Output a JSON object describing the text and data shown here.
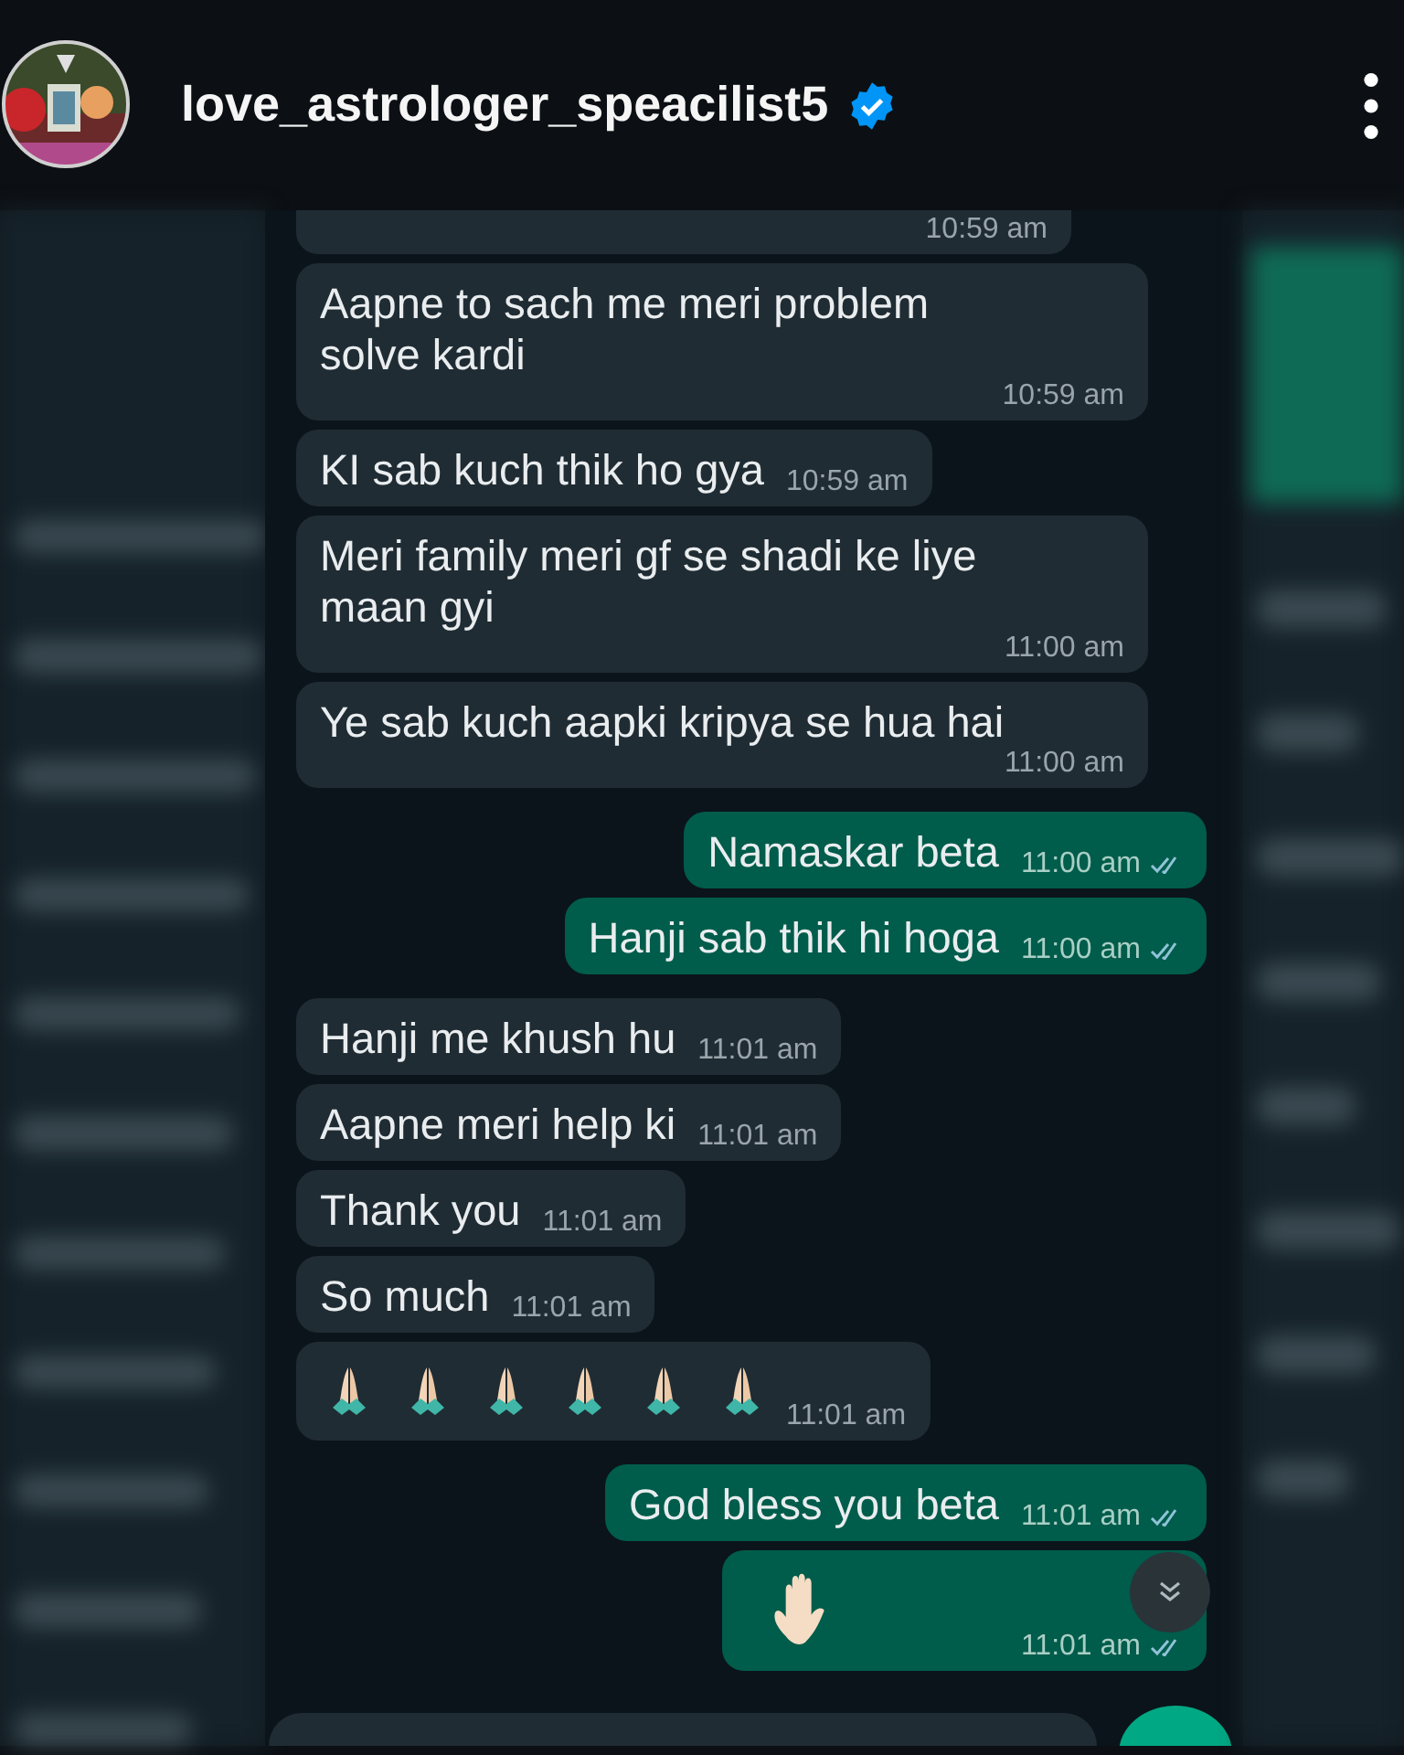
{
  "header": {
    "username": "love_astrologer_speacilist5",
    "verified": true
  },
  "messages": [
    {
      "kind": "incoming",
      "time": "10:59 am",
      "ticks": false
    },
    {
      "kind": "incoming",
      "text": "Aapne to sach me meri problem solve kardi",
      "time": "10:59 am",
      "ticks": false
    },
    {
      "kind": "incoming",
      "text": "KI sab kuch thik ho gya",
      "time": "10:59 am",
      "ticks": false
    },
    {
      "kind": "incoming",
      "text": "Meri family meri gf se shadi ke liye maan gyi",
      "time": "11:00 am",
      "ticks": false
    },
    {
      "kind": "incoming",
      "text": "Ye sab kuch aapki kripya se hua hai",
      "time": "11:00 am",
      "ticks": false
    },
    {
      "kind": "outgoing",
      "text": "Namaskar beta",
      "time": "11:00 am",
      "ticks": true
    },
    {
      "kind": "outgoing",
      "text": "Hanji sab thik hi hoga",
      "time": "11:00 am",
      "ticks": true
    },
    {
      "kind": "incoming",
      "text": "Hanji me khush hu",
      "time": "11:01 am",
      "ticks": false
    },
    {
      "kind": "incoming",
      "text": "Aapne meri help ki",
      "time": "11:01 am",
      "ticks": false
    },
    {
      "kind": "incoming",
      "text": "Thank you",
      "time": "11:01 am",
      "ticks": false
    },
    {
      "kind": "incoming",
      "text": "So much",
      "time": "11:01 am",
      "ticks": false
    },
    {
      "kind": "incoming",
      "emojis": [
        {
          "kind": "praying-hands"
        },
        {
          "kind": "praying-hands"
        },
        {
          "kind": "praying-hands"
        },
        {
          "kind": "praying-hands"
        },
        {
          "kind": "praying-hands"
        },
        {
          "kind": "praying-hands"
        }
      ],
      "time": "11:01 am",
      "ticks": false
    },
    {
      "kind": "outgoing",
      "text": "God bless you beta",
      "time": "11:01 am",
      "ticks": true
    },
    {
      "kind": "outgoing",
      "emojis": [
        {
          "kind": "raised-hand"
        }
      ],
      "time": "11:01 am",
      "ticks": true
    }
  ]
}
